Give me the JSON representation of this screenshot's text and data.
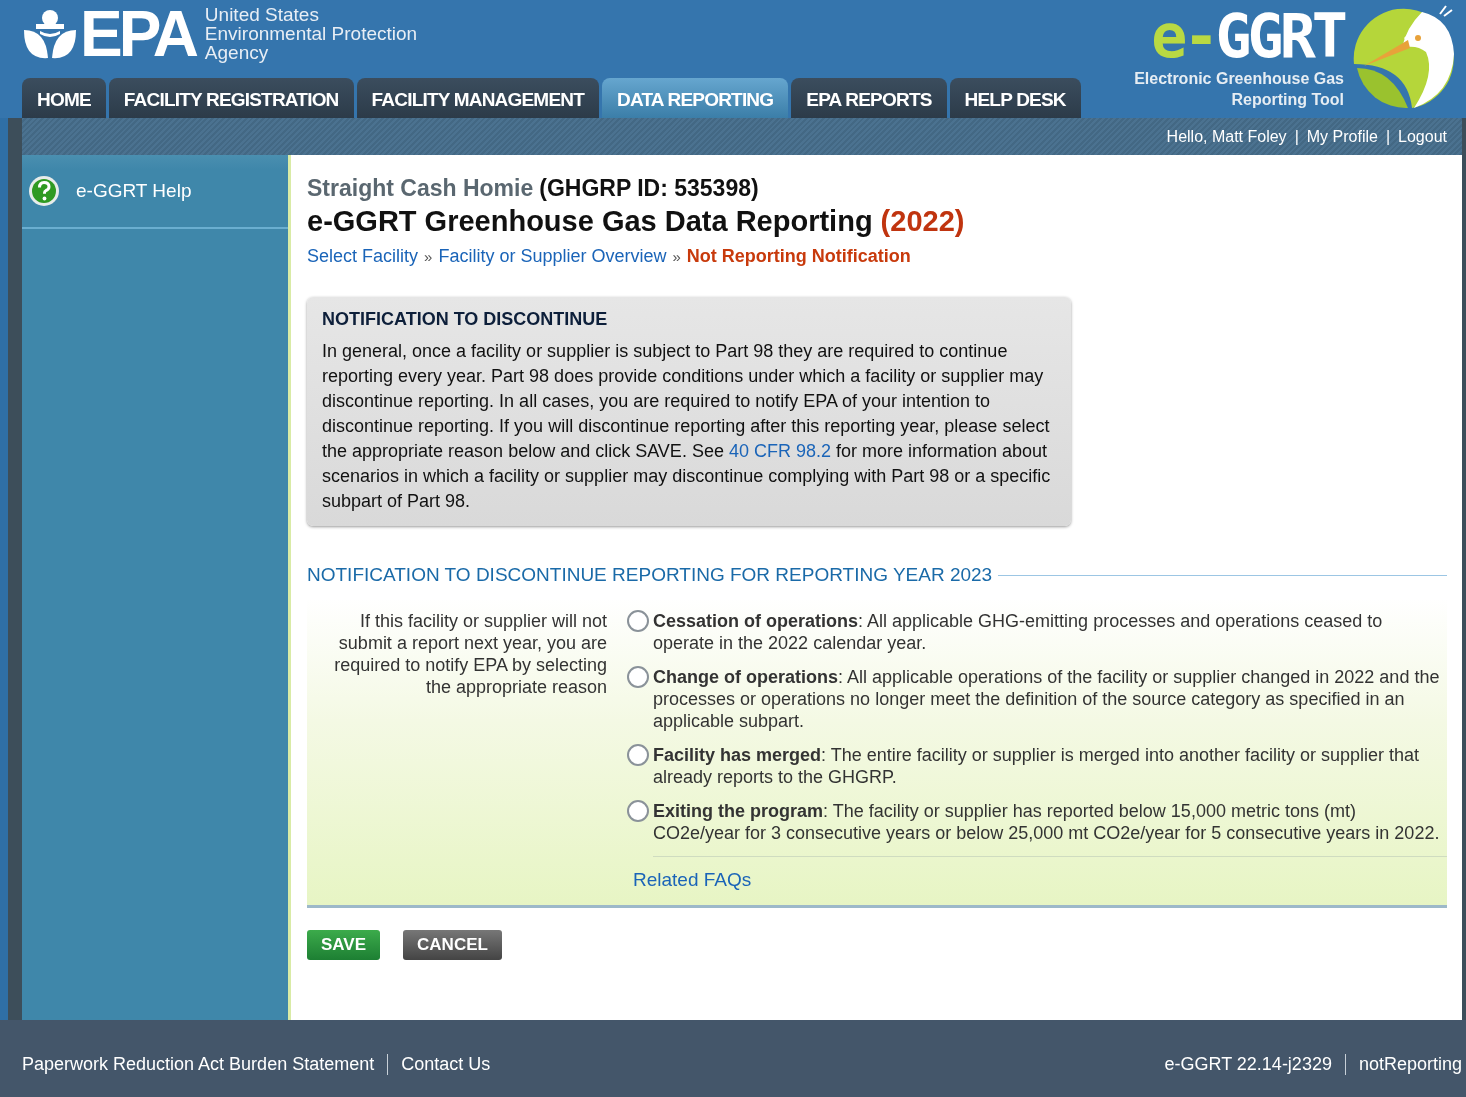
{
  "header": {
    "logo": {
      "mark": "EPA",
      "agency_lines": [
        "United States",
        "Environmental Protection",
        "Agency"
      ]
    },
    "tabs": [
      {
        "label": "HOME",
        "selected": false
      },
      {
        "label": "FACILITY REGISTRATION",
        "selected": false
      },
      {
        "label": "FACILITY MANAGEMENT",
        "selected": false
      },
      {
        "label": "DATA REPORTING",
        "selected": true
      },
      {
        "label": "EPA REPORTS",
        "selected": false
      },
      {
        "label": "HELP DESK",
        "selected": false
      }
    ],
    "app_logo": {
      "prefix": "e-",
      "name": "GGRT",
      "subtitle_lines": [
        "Electronic Greenhouse Gas",
        "Reporting Tool"
      ]
    }
  },
  "user_bar": {
    "greeting": "Hello, Matt Foley",
    "separator": "|",
    "links": [
      "My Profile",
      "Logout"
    ]
  },
  "sidebar": {
    "items": [
      {
        "label": "e-GGRT Help"
      }
    ]
  },
  "page": {
    "facility_name": "Straight Cash Homie",
    "facility_id": "(GHGRP ID: 535398)",
    "title": "e-GGRT Greenhouse Gas Data Reporting",
    "year": "(2022)",
    "breadcrumbs": [
      {
        "label": "Select Facility",
        "current": false
      },
      {
        "label": "Facility or Supplier Overview",
        "current": false
      },
      {
        "label": "Not Reporting Notification",
        "current": true
      }
    ],
    "breadcrumb_separator": "»",
    "notice": {
      "title": "NOTIFICATION TO DISCONTINUE",
      "text_before": "In general, once a facility or supplier is subject to Part 98 they are required to continue reporting every year. Part 98 does provide conditions under which a facility or supplier may discontinue reporting. In all cases, you are required to notify EPA of your intention to discontinue reporting. If you will discontinue reporting after this reporting year, please select the appropriate reason below and click SAVE. See ",
      "link": "40 CFR 98.2",
      "text_after": " for more information about scenarios in which a facility or supplier may discontinue complying with Part 98 or a specific subpart of Part 98."
    },
    "section_heading": "NOTIFICATION TO DISCONTINUE REPORTING FOR REPORTING YEAR 2023",
    "form": {
      "prompt": "If this facility or supplier will not submit a report next year, you are required to notify EPA by selecting the appropriate reason",
      "options": [
        {
          "text": "**Cessation of operations**: All applicable GHG-emitting processes and operations ceased to operate in the 2022 calendar year.",
          "selected": false
        },
        {
          "text": "**Change of operations**: All applicable operations of the facility or supplier changed in 2022 and the processes or operations no longer meet the definition of the source category as specified in an applicable subpart.",
          "selected": false
        },
        {
          "text": "**Facility has merged**: The entire facility or supplier is merged into another facility or supplier that already reports to the GHGRP.",
          "selected": false
        },
        {
          "text": "**Exiting the program**: The facility or supplier has reported below 15,000 metric tons (mt) CO2e/year for 3 consecutive years or below 25,000 mt CO2e/year for 5 consecutive years in 2022.",
          "selected": false
        }
      ],
      "faq_link": "Related FAQs"
    },
    "buttons": [
      {
        "label": "SAVE",
        "kind": "save"
      },
      {
        "label": "CANCEL",
        "kind": "cancel"
      }
    ]
  },
  "footer": {
    "left_links": [
      "Paperwork Reduction Act Burden Statement",
      "Contact Us"
    ],
    "right_texts": [
      "e-GGRT 22.14-j2329",
      "notReporting"
    ]
  }
}
